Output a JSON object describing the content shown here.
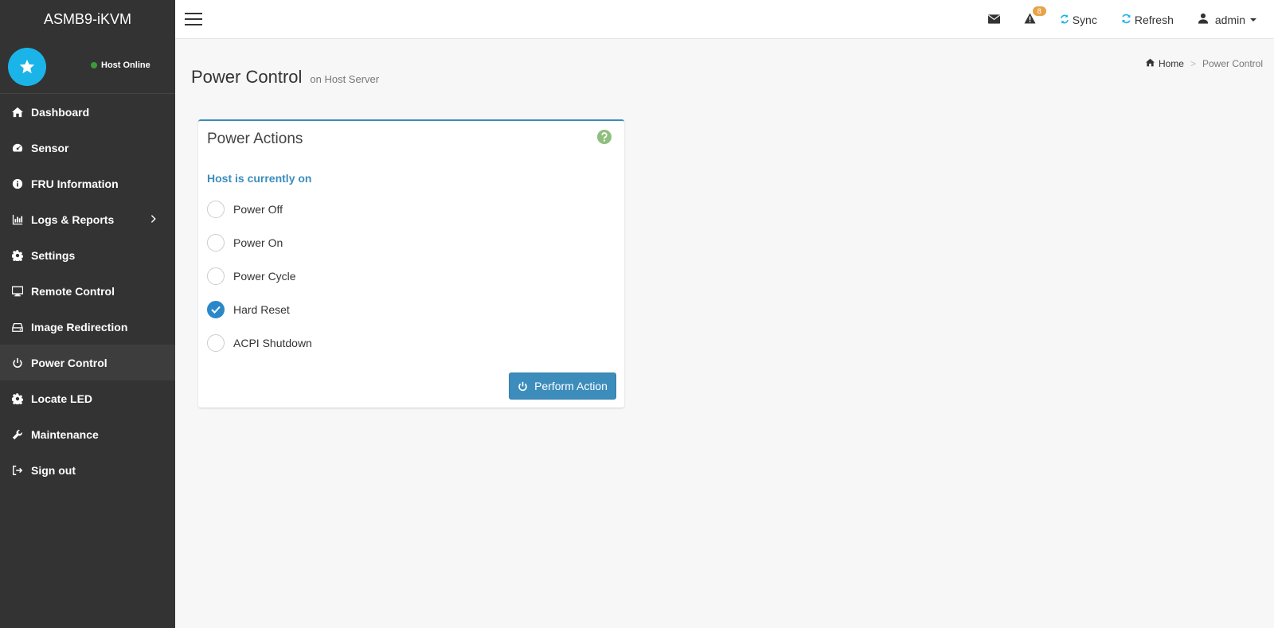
{
  "sidebar": {
    "brand": "ASMB9-iKVM",
    "host_status": "Host Online",
    "items": [
      {
        "label": "Dashboard",
        "icon": "home-icon"
      },
      {
        "label": "Sensor",
        "icon": "dashboard-icon"
      },
      {
        "label": "FRU Information",
        "icon": "info-icon"
      },
      {
        "label": "Logs & Reports",
        "icon": "bar-chart-icon"
      },
      {
        "label": "Settings",
        "icon": "gear-icon"
      },
      {
        "label": "Remote Control",
        "icon": "monitor-icon"
      },
      {
        "label": "Image Redirection",
        "icon": "hdd-icon"
      },
      {
        "label": "Power Control",
        "icon": "power-icon",
        "active": true
      },
      {
        "label": "Locate LED",
        "icon": "gear-icon"
      },
      {
        "label": "Maintenance",
        "icon": "wrench-icon"
      },
      {
        "label": "Sign out",
        "icon": "sign-out-icon"
      }
    ]
  },
  "header": {
    "notification_count": "8",
    "sync_label": "Sync",
    "refresh_label": "Refresh",
    "user_label": "admin"
  },
  "page": {
    "title": "Power Control",
    "subtitle": "on Host Server",
    "breadcrumb_home": "Home",
    "breadcrumb_current": "Power Control"
  },
  "power_actions": {
    "title": "Power Actions",
    "host_state": "Host is currently on",
    "options": [
      {
        "label": "Power Off",
        "selected": false
      },
      {
        "label": "Power On",
        "selected": false
      },
      {
        "label": "Power Cycle",
        "selected": false
      },
      {
        "label": "Hard Reset",
        "selected": true
      },
      {
        "label": "ACPI Shutdown",
        "selected": false
      }
    ],
    "perform_label": "Perform Action"
  },
  "colors": {
    "sidebar_bg": "#333333",
    "accent": "#3c8dbc",
    "avatar": "#1ab4e8",
    "online": "#3c9a3c",
    "badge": "#e8a34a",
    "help": "#8fbf7f"
  }
}
